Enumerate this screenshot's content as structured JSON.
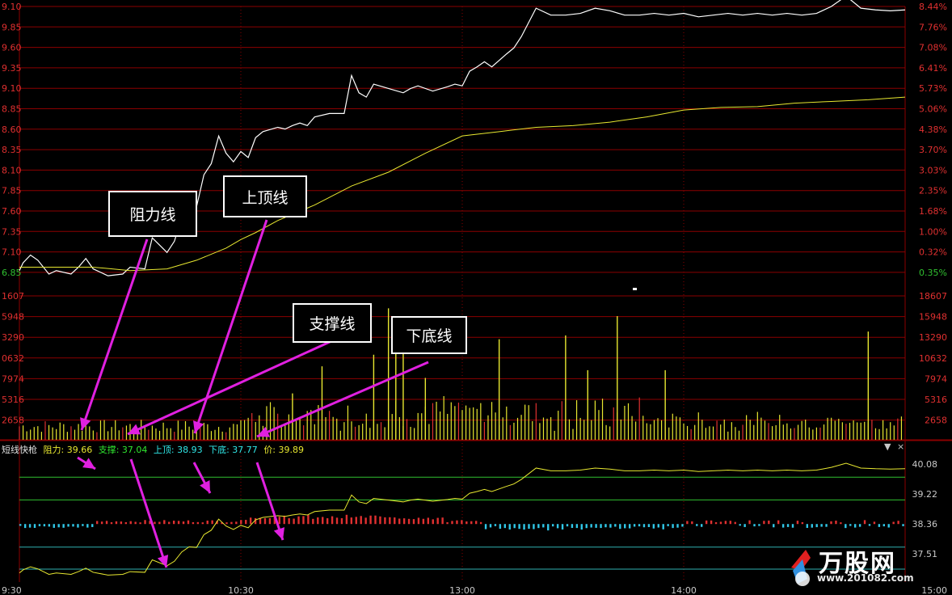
{
  "chart_data": [
    {
      "type": "line",
      "panel": "price",
      "y_ticks_left": [
        "9.85",
        "9.60",
        "9.35",
        "9.10",
        "8.85",
        "8.60",
        "8.35",
        "8.10",
        "7.85",
        "7.60",
        "7.35",
        "7.10",
        "6.85"
      ],
      "y_ticks_right": [
        "7.76%",
        "7.08%",
        "6.41%",
        "5.73%",
        "5.06%",
        "4.38%",
        "3.70%",
        "3.03%",
        "2.35%",
        "1.68%",
        "1.00%",
        "0.32%",
        "0.35%"
      ],
      "top_left_label": "9.10",
      "top_right_label": "8.44%",
      "ylim": [
        6.8,
        9.9
      ],
      "grid": true,
      "series": [
        {
          "color": "#ffffff",
          "x": [
            0,
            1,
            3,
            5,
            8,
            10,
            14,
            16,
            18,
            20,
            24,
            28,
            30,
            34,
            36,
            40,
            42,
            44,
            46,
            48,
            50,
            52,
            54,
            56,
            58,
            60,
            62,
            64,
            66,
            70,
            72,
            74,
            76,
            78,
            80,
            84,
            88,
            90,
            92,
            94,
            96,
            100,
            104,
            106,
            108,
            112,
            116,
            118,
            120,
            122,
            124,
            126,
            128,
            132,
            134,
            136,
            140,
            144,
            148,
            152,
            156,
            160,
            164,
            168,
            172,
            176,
            180,
            184,
            188,
            192,
            196,
            200,
            204,
            208,
            212,
            216,
            220,
            224,
            228,
            232,
            236,
            240
          ],
          "values": [
            6.84,
            6.93,
            7.02,
            6.96,
            6.8,
            6.84,
            6.8,
            6.88,
            6.98,
            6.86,
            6.78,
            6.8,
            6.88,
            6.86,
            7.22,
            7.05,
            7.18,
            7.45,
            7.6,
            7.58,
            7.95,
            8.08,
            8.4,
            8.2,
            8.1,
            8.22,
            8.15,
            8.38,
            8.45,
            8.5,
            8.48,
            8.52,
            8.55,
            8.52,
            8.62,
            8.66,
            8.66,
            9.1,
            8.9,
            8.85,
            9.0,
            8.95,
            8.9,
            8.95,
            8.98,
            8.92,
            8.97,
            9.0,
            8.98,
            9.15,
            9.2,
            9.26,
            9.2,
            9.35,
            9.42,
            9.55,
            9.88,
            9.8,
            9.8,
            9.82,
            9.88,
            9.85,
            9.8,
            9.8,
            9.82,
            9.8,
            9.82,
            9.78,
            9.8,
            9.82,
            9.8,
            9.82,
            9.8,
            9.82,
            9.8,
            9.82,
            9.9,
            10.02,
            9.88,
            9.86,
            9.85,
            9.86
          ]
        },
        {
          "color": "#e8e830",
          "x": [
            0,
            20,
            30,
            40,
            48,
            56,
            60,
            64,
            70,
            80,
            90,
            100,
            110,
            120,
            130,
            140,
            150,
            160,
            170,
            180,
            190,
            200,
            210,
            220,
            230,
            240
          ],
          "values": [
            6.88,
            6.88,
            6.84,
            6.86,
            6.96,
            7.1,
            7.2,
            7.28,
            7.42,
            7.6,
            7.82,
            7.98,
            8.2,
            8.4,
            8.45,
            8.5,
            8.52,
            8.56,
            8.62,
            8.7,
            8.73,
            8.74,
            8.78,
            8.8,
            8.82,
            8.85
          ]
        }
      ]
    },
    {
      "type": "bar",
      "panel": "volume",
      "y_ticks_left": [
        "1607",
        "5948",
        "3290",
        "0632",
        "7974",
        "5316",
        "2658"
      ],
      "y_ticks_right": [
        "18607",
        "15948",
        "13290",
        "10632",
        "7974",
        "5316",
        "2658"
      ],
      "ylim": [
        0,
        18607
      ],
      "spikes": [
        {
          "x": 96,
          "values": 11000
        },
        {
          "x": 100,
          "values": 17000
        },
        {
          "x": 102,
          "values": 15000
        },
        {
          "x": 104,
          "values": 13000
        },
        {
          "x": 110,
          "values": 8000
        },
        {
          "x": 130,
          "values": 13000
        },
        {
          "x": 148,
          "values": 13500
        },
        {
          "x": 154,
          "values": 9000
        },
        {
          "x": 162,
          "values": 16000
        },
        {
          "x": 175,
          "values": 9000
        },
        {
          "x": 230,
          "values": 14000
        },
        {
          "x": 82,
          "values": 9500
        },
        {
          "x": 74,
          "values": 6000
        }
      ]
    },
    {
      "type": "line",
      "panel": "indicator",
      "title": "短线快枪",
      "legend": [
        {
          "label": "阻力: 39.66",
          "color": "#e8e830"
        },
        {
          "label": "支撑: 37.04",
          "color": "#30e830"
        },
        {
          "label": "上顶: 38.93",
          "color": "#30e8e8"
        },
        {
          "label": "下底: 37.77",
          "color": "#30e8e8"
        },
        {
          "label": "价: 39.89",
          "color": "#e8e830"
        }
      ],
      "y_ticks_right": [
        "40.08",
        "39.22",
        "38.36",
        "37.51"
      ],
      "ylim": [
        36.7,
        40.4
      ],
      "hlines": [
        39.7,
        39.05,
        37.7,
        37.07
      ],
      "hline_colors": [
        "#30c030",
        "#30c030",
        "#30b0b0",
        "#30b0b0"
      ]
    }
  ],
  "x_ticks": [
    "9:30",
    "10:30",
    "13:00",
    "14:00",
    "15:00"
  ],
  "callouts": [
    {
      "label": "阻力线"
    },
    {
      "label": "上顶线"
    },
    {
      "label": "支撑线"
    },
    {
      "label": "下底线"
    }
  ],
  "logo": {
    "name": "万股网",
    "url": "www.201082.com"
  },
  "controls": {
    "dropdown": "▼",
    "close": "×"
  },
  "colors": {
    "grid": "#8b0000",
    "price": "#ffffff",
    "avg": "#e8e830",
    "volume": "#e8e830",
    "arrow": "#e020e0",
    "up_bar": "#e03030",
    "down_bar": "#30c8e8"
  }
}
